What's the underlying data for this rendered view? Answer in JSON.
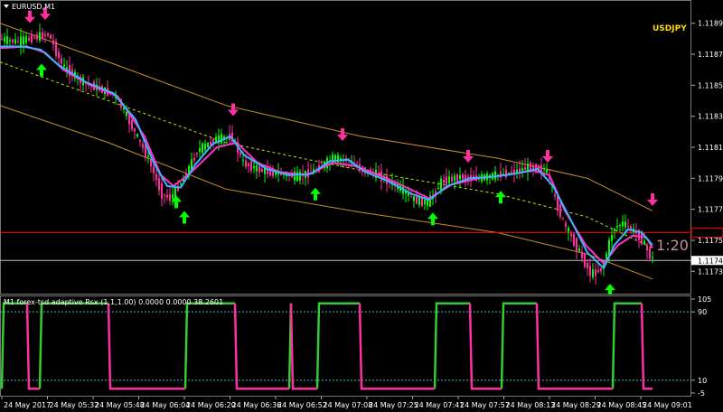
{
  "window": {
    "title": "EURUSD,M1",
    "menu_icon": "triangle-down-icon"
  },
  "overlay": {
    "symbol_label": "USDJPY",
    "ratio_label": "1:20"
  },
  "indicator": {
    "title": "M1 forex-tsd adaptive Rsx (1,1,1.00) 0.0000 0.0000 38.2601",
    "scale": [
      "105",
      "90",
      "10",
      "-5"
    ],
    "levels": [
      90,
      10
    ],
    "range": [
      -5,
      105
    ]
  },
  "price_scale": {
    "labels": [
      "1.11895",
      "1.11875",
      "1.11855",
      "1.11835",
      "1.11815",
      "1.11795",
      "1.11775",
      "1.11755",
      "1.11740",
      "1.11735"
    ],
    "current_price": "1.11740",
    "red_line_price": 1.1176,
    "white_line_price": 1.11742,
    "range": [
      1.1172,
      1.1191
    ]
  },
  "time_axis": {
    "labels": [
      "24 May 2017",
      "24 May 05:32",
      "24 May 05:48",
      "24 May 06:04",
      "24 May 06:20",
      "24 May 06:36",
      "24 May 06:52",
      "24 May 07:08",
      "24 May 07:25",
      "24 May 07:41",
      "24 May 07:57",
      "24 May 08:13",
      "24 May 08:29",
      "24 May 08:45",
      "24 May 09:01"
    ]
  },
  "colors": {
    "background": "#000000",
    "bull": "#00ff00",
    "bear": "#ff2f9f",
    "envelope": "#c8902a",
    "mid_dash": "#d2e000",
    "ma_blue": "#3cb4ff",
    "ma_magenta": "#ff33cc",
    "red_line": "#ff0000",
    "sub_level": "#40c0c0",
    "rsx_up": "#33cc33",
    "rsx_down": "#ff2f9f"
  },
  "chart_data": {
    "type": "candlestick",
    "symbol": "EURUSD",
    "timeframe": "M1",
    "price_path": [
      [
        0,
        1.11885
      ],
      [
        20,
        1.11883
      ],
      [
        40,
        1.11886
      ],
      [
        55,
        1.11888
      ],
      [
        70,
        1.11868
      ],
      [
        90,
        1.11858
      ],
      [
        110,
        1.11853
      ],
      [
        130,
        1.11848
      ],
      [
        150,
        1.11825
      ],
      [
        165,
        1.11808
      ],
      [
        180,
        1.11785
      ],
      [
        190,
        1.11782
      ],
      [
        205,
        1.11796
      ],
      [
        220,
        1.11813
      ],
      [
        240,
        1.1182
      ],
      [
        258,
        1.11822
      ],
      [
        270,
        1.11805
      ],
      [
        290,
        1.118
      ],
      [
        310,
        1.11798
      ],
      [
        330,
        1.11796
      ],
      [
        350,
        1.118
      ],
      [
        370,
        1.11808
      ],
      [
        385,
        1.11807
      ],
      [
        400,
        1.11801
      ],
      [
        420,
        1.11797
      ],
      [
        440,
        1.1179
      ],
      [
        460,
        1.11781
      ],
      [
        475,
        1.11779
      ],
      [
        490,
        1.11793
      ],
      [
        510,
        1.11796
      ],
      [
        530,
        1.11795
      ],
      [
        550,
        1.11797
      ],
      [
        570,
        1.11799
      ],
      [
        585,
        1.11802
      ],
      [
        605,
        1.11801
      ],
      [
        615,
        1.11782
      ],
      [
        625,
        1.11766
      ],
      [
        640,
        1.1175
      ],
      [
        655,
        1.11733
      ],
      [
        668,
        1.11737
      ],
      [
        680,
        1.11763
      ],
      [
        690,
        1.11766
      ],
      [
        700,
        1.11762
      ],
      [
        710,
        1.11757
      ],
      [
        722,
        1.11743
      ]
    ],
    "ma_blue": [
      [
        0,
        1.1188
      ],
      [
        25,
        1.1188
      ],
      [
        45,
        1.11878
      ],
      [
        65,
        1.11868
      ],
      [
        95,
        1.11857
      ],
      [
        125,
        1.1185
      ],
      [
        150,
        1.11833
      ],
      [
        170,
        1.11805
      ],
      [
        185,
        1.1179
      ],
      [
        200,
        1.11789
      ],
      [
        215,
        1.11803
      ],
      [
        235,
        1.11817
      ],
      [
        255,
        1.11822
      ],
      [
        270,
        1.1181
      ],
      [
        295,
        1.11801
      ],
      [
        320,
        1.11797
      ],
      [
        345,
        1.11798
      ],
      [
        365,
        1.11806
      ],
      [
        385,
        1.11807
      ],
      [
        405,
        1.11799
      ],
      [
        430,
        1.11793
      ],
      [
        455,
        1.11785
      ],
      [
        475,
        1.11781
      ],
      [
        495,
        1.1179
      ],
      [
        520,
        1.11795
      ],
      [
        545,
        1.11796
      ],
      [
        570,
        1.11798
      ],
      [
        595,
        1.11801
      ],
      [
        612,
        1.1179
      ],
      [
        630,
        1.1177
      ],
      [
        650,
        1.11747
      ],
      [
        668,
        1.11737
      ],
      [
        680,
        1.11752
      ],
      [
        695,
        1.11762
      ],
      [
        710,
        1.1176
      ],
      [
        722,
        1.11752
      ]
    ],
    "ma_magenta": [
      [
        0,
        1.11879
      ],
      [
        30,
        1.1188
      ],
      [
        50,
        1.11876
      ],
      [
        70,
        1.11865
      ],
      [
        100,
        1.11855
      ],
      [
        130,
        1.11848
      ],
      [
        160,
        1.11822
      ],
      [
        178,
        1.11797
      ],
      [
        192,
        1.1179
      ],
      [
        210,
        1.11798
      ],
      [
        240,
        1.11815
      ],
      [
        262,
        1.11818
      ],
      [
        285,
        1.11805
      ],
      [
        310,
        1.11799
      ],
      [
        340,
        1.11797
      ],
      [
        368,
        1.11805
      ],
      [
        392,
        1.11803
      ],
      [
        420,
        1.11797
      ],
      [
        450,
        1.11789
      ],
      [
        475,
        1.11782
      ],
      [
        500,
        1.11791
      ],
      [
        530,
        1.11795
      ],
      [
        560,
        1.11797
      ],
      [
        590,
        1.118
      ],
      [
        608,
        1.11797
      ],
      [
        625,
        1.11774
      ],
      [
        648,
        1.11752
      ],
      [
        668,
        1.1174
      ],
      [
        684,
        1.11752
      ],
      [
        700,
        1.11758
      ],
      [
        715,
        1.11757
      ],
      [
        722,
        1.1175
      ]
    ],
    "envelope_upper": [
      [
        0,
        1.11895
      ],
      [
        120,
        1.1187
      ],
      [
        250,
        1.11842
      ],
      [
        400,
        1.11822
      ],
      [
        550,
        1.11808
      ],
      [
        650,
        1.11795
      ],
      [
        722,
        1.11774
      ]
    ],
    "envelope_middle": [
      [
        0,
        1.1187
      ],
      [
        120,
        1.11845
      ],
      [
        250,
        1.11818
      ],
      [
        400,
        1.118
      ],
      [
        550,
        1.11785
      ],
      [
        650,
        1.1177
      ],
      [
        722,
        1.1175
      ]
    ],
    "envelope_lower": [
      [
        0,
        1.11842
      ],
      [
        120,
        1.11818
      ],
      [
        250,
        1.11788
      ],
      [
        400,
        1.11773
      ],
      [
        550,
        1.1176
      ],
      [
        650,
        1.11746
      ],
      [
        722,
        1.1173
      ]
    ],
    "sell_arrows": [
      [
        33,
        1.11898
      ],
      [
        50,
        1.119
      ],
      [
        258,
        1.11838
      ],
      [
        379,
        1.11822
      ],
      [
        518,
        1.11808
      ],
      [
        606,
        1.11808
      ],
      [
        722,
        1.1178
      ]
    ],
    "buy_arrows": [
      [
        46,
        1.11866
      ],
      [
        195,
        1.11781
      ],
      [
        204,
        1.11771
      ],
      [
        349,
        1.11786
      ],
      [
        479,
        1.1177
      ],
      [
        554,
        1.11784
      ],
      [
        675,
        1.11724
      ]
    ],
    "rsx_up_segments": [
      [
        2,
        30
      ],
      [
        44,
        120
      ],
      [
        205,
        260
      ],
      [
        320,
        322
      ],
      [
        351,
        398
      ],
      [
        481,
        520
      ],
      [
        555,
        594
      ],
      [
        678,
        710
      ]
    ],
    "rsx_down_segments": [
      [
        30,
        44
      ],
      [
        120,
        205
      ],
      [
        260,
        320
      ],
      [
        322,
        351
      ],
      [
        398,
        481
      ],
      [
        520,
        555
      ],
      [
        594,
        678
      ],
      [
        710,
        722
      ]
    ]
  }
}
